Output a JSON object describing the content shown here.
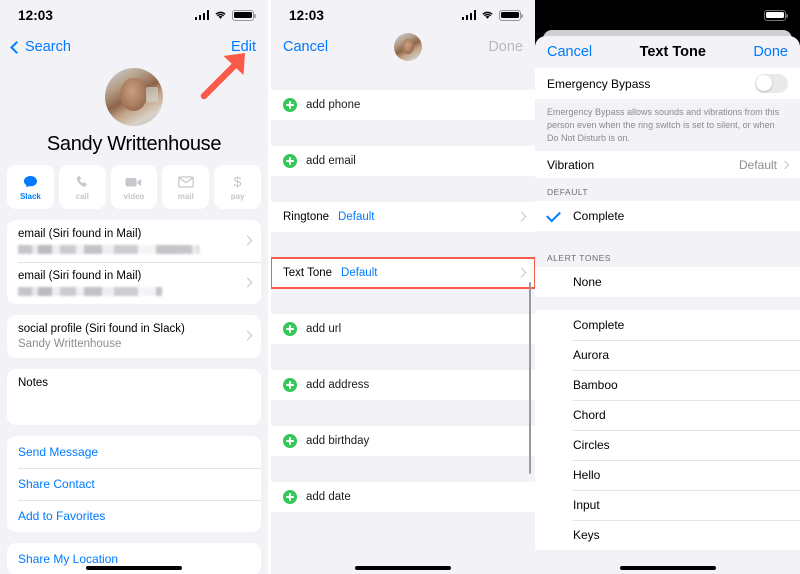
{
  "status_bar": {
    "time": "12:03",
    "icons": [
      "cellular-signal-icon",
      "wifi-icon",
      "battery-icon"
    ]
  },
  "panel1": {
    "nav": {
      "back_label": "Search",
      "edit_label": "Edit"
    },
    "contact_name": "Sandy Writtenhouse",
    "actions": [
      {
        "label": "Slack",
        "icon": "message-bubble-icon",
        "active": true
      },
      {
        "label": "call",
        "icon": "phone-icon",
        "active": false
      },
      {
        "label": "video",
        "icon": "video-camera-icon",
        "active": false
      },
      {
        "label": "mail",
        "icon": "envelope-icon",
        "active": false
      },
      {
        "label": "pay",
        "icon": "dollar-sign-icon",
        "active": false
      }
    ],
    "info_rows": [
      {
        "label": "email (Siri found in Mail)",
        "value": "",
        "redacted": true
      },
      {
        "label": "email (Siri found in Mail)",
        "value": "",
        "redacted": true
      }
    ],
    "social_row": {
      "label": "social profile (Siri found in Slack)",
      "value": "Sandy Writtenhouse"
    },
    "notes_label": "Notes",
    "links": [
      "Send Message",
      "Share Contact",
      "Add to Favorites"
    ],
    "share_location": "Share My Location",
    "annotation": {
      "type": "red-arrow",
      "points_to": "Edit",
      "color": "#fb5a4b"
    }
  },
  "panel2": {
    "nav": {
      "cancel_label": "Cancel",
      "done_label": "Done"
    },
    "add_rows_top": [
      "add phone",
      "add email"
    ],
    "ringtone": {
      "label": "Ringtone",
      "value": "Default"
    },
    "text_tone": {
      "label": "Text Tone",
      "value": "Default",
      "highlighted": true
    },
    "add_rows_bottom": [
      "add url",
      "add address",
      "add birthday",
      "add date"
    ]
  },
  "panel3": {
    "nav": {
      "cancel_label": "Cancel",
      "title": "Text Tone",
      "done_label": "Done"
    },
    "emergency_bypass": {
      "label": "Emergency Bypass",
      "enabled": false
    },
    "bypass_note": "Emergency Bypass allows sounds and vibrations from this person even when the ring switch is set to silent, or when Do Not Disturb is on.",
    "vibration": {
      "label": "Vibration",
      "value": "Default"
    },
    "default_section": {
      "header": "DEFAULT",
      "items": [
        {
          "name": "Complete",
          "selected": true
        }
      ]
    },
    "alert_section": {
      "header": "ALERT TONES",
      "items": [
        {
          "name": "None",
          "selected": false
        },
        {
          "name": "Complete",
          "selected": false
        },
        {
          "name": "Aurora",
          "selected": false
        },
        {
          "name": "Bamboo",
          "selected": false
        },
        {
          "name": "Chord",
          "selected": false
        },
        {
          "name": "Circles",
          "selected": false
        },
        {
          "name": "Hello",
          "selected": false
        },
        {
          "name": "Input",
          "selected": false
        },
        {
          "name": "Keys",
          "selected": false
        }
      ]
    }
  },
  "colors": {
    "accent": "#007aff",
    "highlight": "#fb5a4b",
    "green": "#34c759",
    "background": "#f2f2f7"
  }
}
